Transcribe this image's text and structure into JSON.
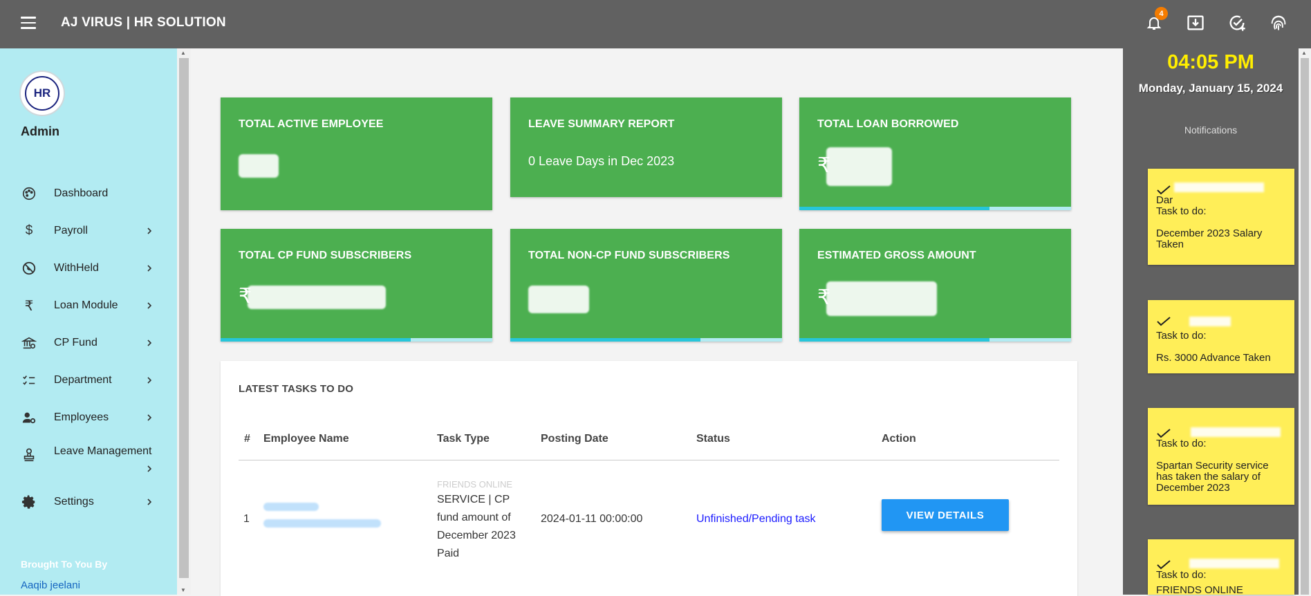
{
  "header": {
    "title": "AJ VIRUS | HR SOLUTION",
    "notification_count": "4",
    "icons": [
      "bell-icon",
      "download-box-icon",
      "check-circle-plus-icon",
      "fingerprint-icon"
    ]
  },
  "sidebar": {
    "avatar_text": "HR",
    "user": "Admin",
    "items": [
      {
        "label": "Dashboard",
        "icon": "palette-icon",
        "has_submenu": false
      },
      {
        "label": "Payroll",
        "icon": "dollar-icon",
        "has_submenu": true
      },
      {
        "label": "WithHeld",
        "icon": "blocked-icon",
        "has_submenu": true
      },
      {
        "label": "Loan Module",
        "icon": "rupee-icon",
        "has_submenu": true
      },
      {
        "label": "CP Fund",
        "icon": "bank-icon",
        "has_submenu": true
      },
      {
        "label": "Department",
        "icon": "checklist-icon",
        "has_submenu": true
      },
      {
        "label": "Employees",
        "icon": "user-gear-icon",
        "has_submenu": true
      },
      {
        "label": "Leave Management",
        "icon": "stamp-icon",
        "has_submenu": true
      },
      {
        "label": "Settings",
        "icon": "gear-icon",
        "has_submenu": true
      }
    ],
    "footer_label": "Brought To You By",
    "author": "Aaqib jeelani"
  },
  "cards": [
    {
      "title": "TOTAL ACTIVE EMPLOYEE",
      "value": "",
      "prefix": "",
      "progress": null
    },
    {
      "title": "LEAVE SUMMARY REPORT",
      "value": "0 Leave Days in Dec 2023",
      "prefix": "",
      "progress": null
    },
    {
      "title": "TOTAL LOAN BORROWED",
      "value": "",
      "prefix": "₹",
      "progress": 0.7
    },
    {
      "title": "TOTAL CP FUND SUBSCRIBERS",
      "value": "",
      "prefix": "₹",
      "progress": 0.7
    },
    {
      "title": "TOTAL NON-CP FUND SUBSCRIBERS",
      "value": "",
      "prefix": "",
      "progress": 0.7
    },
    {
      "title": "ESTIMATED GROSS AMOUNT",
      "value": "",
      "prefix": "₹",
      "progress": 0.7
    }
  ],
  "tasks": {
    "title": "LATEST TASKS TO DO",
    "columns": [
      "#",
      "Employee Name",
      "Task Type",
      "Posting Date",
      "Status",
      "Action"
    ],
    "rows": [
      {
        "num": "1",
        "task_type_line1": "FRIENDS ONLINE",
        "task_type_rest": "SERVICE | CP fund amount of December 2023 Paid",
        "posting_date": "2024-01-11 00:00:00",
        "status": "Unfinished/Pending task",
        "action": "VIEW DETAILS"
      }
    ]
  },
  "right_panel": {
    "time": "04:05 PM",
    "date": "Monday, January 15, 2024",
    "notifications_label": "Notifications",
    "notifications": [
      {
        "name_line2": "Dar",
        "task_label": "Task to do:",
        "task": "December 2023 Salary Taken"
      },
      {
        "name_line2": "",
        "task_label": "Task to do:",
        "task": "Rs. 3000 Advance Taken"
      },
      {
        "name_line2": "",
        "task_label": "Task to do:",
        "task": "Spartan Security service has taken the salary of December 2023"
      },
      {
        "name_line2": "",
        "task_label": "Task to do:",
        "task": "FRIENDS ONLINE"
      }
    ]
  },
  "colors": {
    "topbar": "#616161",
    "sidebar": "#b2ebf2",
    "card": "#4caf50",
    "progress": "#26c6da",
    "notif": "#ffee58",
    "clock": "#ffee00",
    "button": "#2196f3"
  }
}
